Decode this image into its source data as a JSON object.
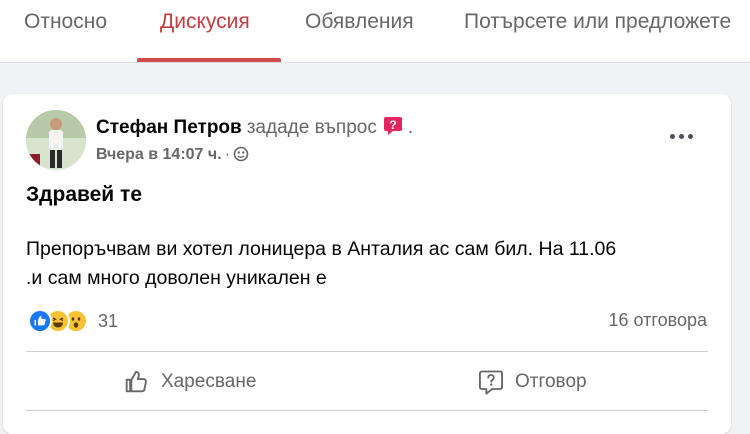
{
  "tabs": [
    {
      "label": "Относно"
    },
    {
      "label": "Дискусия",
      "active": true
    },
    {
      "label": "Обявления"
    },
    {
      "label": "Потърсете или предложете"
    }
  ],
  "colors": {
    "accent": "#d14a4a",
    "like_blue": "#1877f2",
    "question_pink": "#e4265f"
  },
  "post": {
    "author": "Стефан Петров",
    "action": "зададе въпрос",
    "trailing_dot": ".",
    "time": "Вчера в 14:07 ч.",
    "separator": "·",
    "audience_icon": "globe-icon",
    "title": "Здравей те",
    "body": "Препоръчвам ви хотел лоницера в Анталия ас сам бил. На 11.06\n.и сам много доволен  уникален е",
    "reactions": [
      "like",
      "haha",
      "wow"
    ],
    "reaction_count": "31",
    "answers": "16 отговора",
    "like_label": "Харесване",
    "answer_label": "Отговор"
  }
}
